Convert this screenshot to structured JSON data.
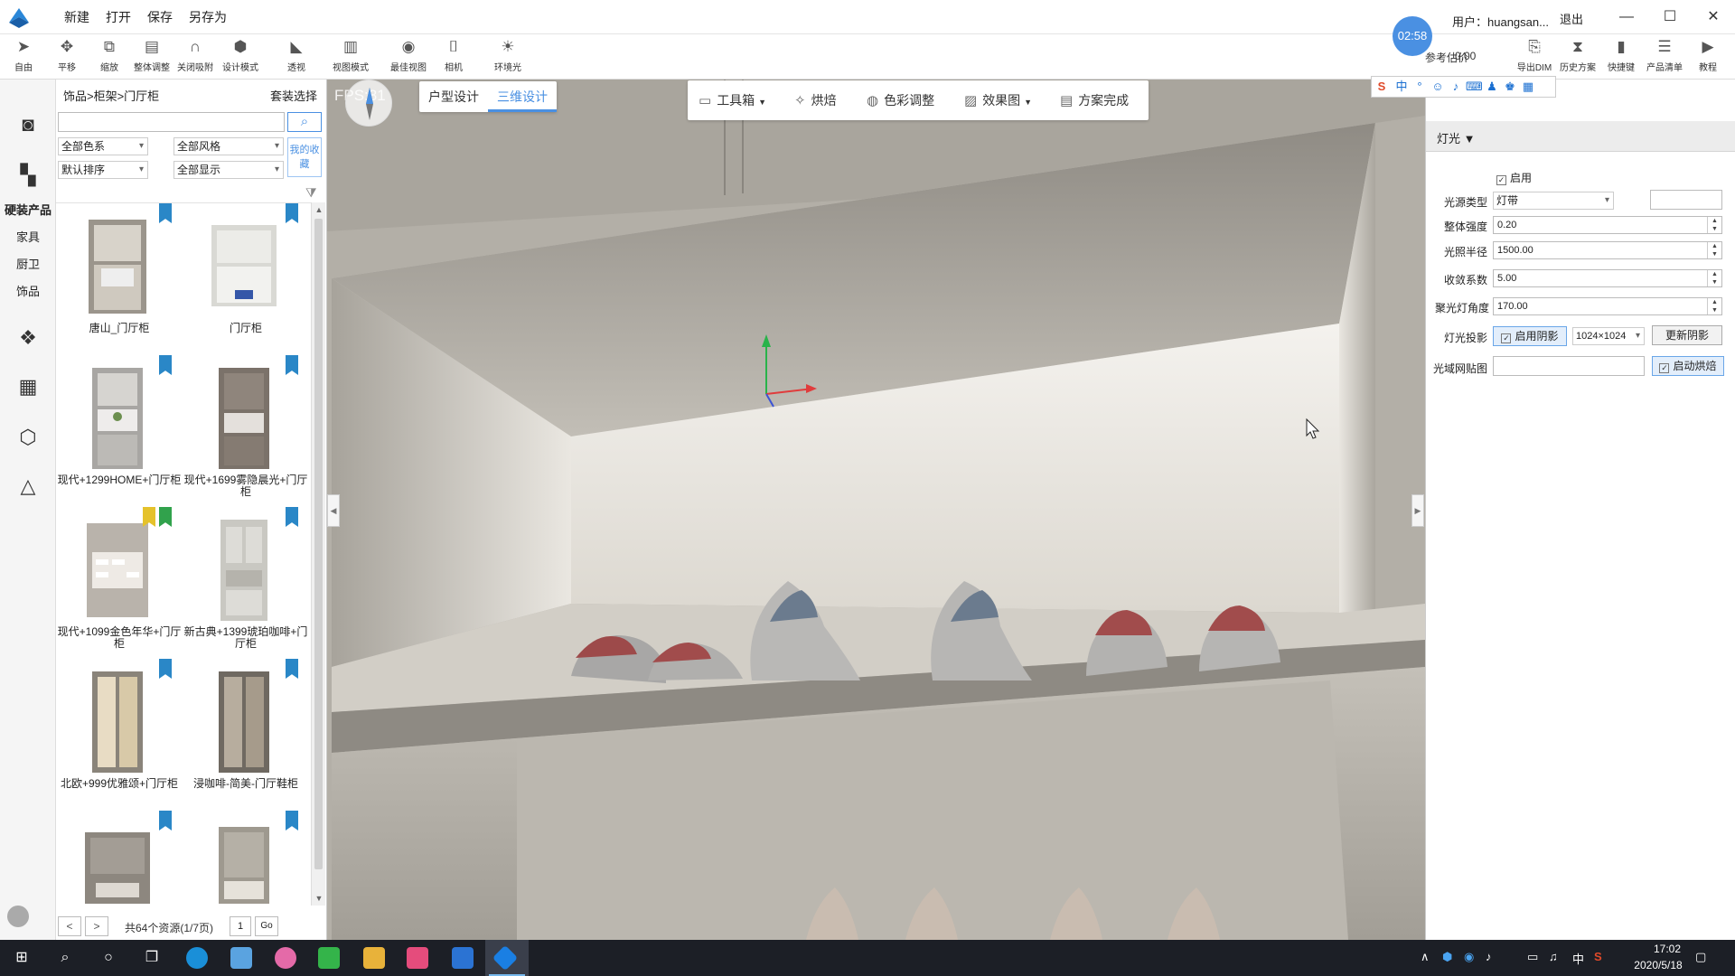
{
  "titlebar": {
    "menu": [
      "新建",
      "打开",
      "保存",
      "另存为"
    ],
    "timer": "02:58",
    "user": "用户：huangsan...",
    "logout": "退出",
    "window_controls": {
      "minimize": "—",
      "maximize": "☐",
      "close": "✕"
    }
  },
  "toolbar": {
    "tools": [
      {
        "label": "自由",
        "icon": "cursor-icon"
      },
      {
        "label": "平移",
        "icon": "move-icon"
      },
      {
        "label": "缩放",
        "icon": "scale-icon"
      },
      {
        "label": "整体调整",
        "icon": "adjust-icon"
      },
      {
        "label": "关闭吸附",
        "icon": "magnet-icon"
      },
      {
        "label": "设计模式",
        "icon": "cube-icon"
      },
      {
        "label": "透视",
        "icon": "perspective-icon"
      },
      {
        "label": "视图模式",
        "icon": "view-mode-icon"
      },
      {
        "label": "最佳视图",
        "icon": "eye-icon"
      },
      {
        "label": "相机",
        "icon": "camera-icon"
      },
      {
        "label": "环境光",
        "icon": "bulb-icon"
      }
    ],
    "right_tools": [
      {
        "label": "导出DIM",
        "icon": "export-icon"
      },
      {
        "label": "历史方案",
        "icon": "hourglass-icon"
      },
      {
        "label": "快捷键",
        "icon": "bookmark-icon"
      },
      {
        "label": "产品清单",
        "icon": "list-icon"
      },
      {
        "label": "教程",
        "icon": "video-icon"
      }
    ],
    "price_label": "参考估价",
    "price_value": "0.00"
  },
  "rail": {
    "items": [
      "硬装产品",
      "家具",
      "厨卫",
      "饰品"
    ],
    "active": "饰品"
  },
  "panel": {
    "breadcrumb": "饰品>柜架>门厅柜",
    "kit_select": "套装选择",
    "search_placeholder": "",
    "filters": {
      "color": "全部色系",
      "style": "全部风格",
      "sort": "默认排序",
      "display": "全部显示"
    },
    "favorites": "我的收藏",
    "products": [
      {
        "name": "唐山_门厅柜",
        "tag": "blue"
      },
      {
        "name": "门厅柜",
        "tag": "blue"
      },
      {
        "name": "现代+1299HOME+门厅柜",
        "tag": "blue"
      },
      {
        "name": "现代+1699雾隐晨光+门厅柜",
        "tag": "blue"
      },
      {
        "name": "现代+1099金色年华+门厅柜",
        "tag": "green"
      },
      {
        "name": "新古典+1399琥珀咖啡+门厅柜",
        "tag": "blue"
      },
      {
        "name": "北欧+999优雅颂+门厅柜",
        "tag": "blue"
      },
      {
        "name": "浸咖啡-简美-门厅鞋柜",
        "tag": "blue"
      },
      {
        "name": "",
        "tag": "blue"
      },
      {
        "name": "",
        "tag": "blue"
      }
    ],
    "pager": {
      "prev": "<",
      "next": ">",
      "info": "共64个资源(1/7页)",
      "page": "1",
      "go": "Go"
    }
  },
  "viewport": {
    "fps": "FPS:81",
    "tabs": [
      "户型设计",
      "三维设计"
    ],
    "active_tab": "三维设计",
    "view_tools": [
      {
        "label": "工具箱",
        "icon": "toolbox-icon",
        "dropdown": true
      },
      {
        "label": "烘焙",
        "icon": "wand-icon",
        "dropdown": false
      },
      {
        "label": "色彩调整",
        "icon": "palette-icon",
        "dropdown": false
      },
      {
        "label": "效果图",
        "icon": "image-icon",
        "dropdown": true
      },
      {
        "label": "方案完成",
        "icon": "document-icon",
        "dropdown": false
      }
    ]
  },
  "props": {
    "section": "灯光",
    "enable": "启用",
    "light_type_label": "光源类型",
    "light_type": "灯带",
    "intensity_label": "整体强度",
    "intensity": "0.20",
    "radius_label": "光照半径",
    "radius": "1500.00",
    "falloff_label": "收敛系数",
    "falloff": "5.00",
    "spot_angle_label": "聚光灯角度",
    "spot_angle": "170.00",
    "shadow_label": "灯光投影",
    "shadow_enable": "启用阴影",
    "shadow_res": "1024×1024",
    "update_shadow": "更新阴影",
    "ies_label": "光域网贴图",
    "bake_enable": "启动烘焙"
  },
  "taskbar": {
    "tray": [
      "∧",
      "中"
    ],
    "time": "17:02",
    "date": "2020/5/18"
  },
  "colors": {
    "accent": "#4a90e2",
    "taskbar": "#1c1f26",
    "tag_blue": "#2a87c7",
    "tag_green": "#31a24c"
  }
}
